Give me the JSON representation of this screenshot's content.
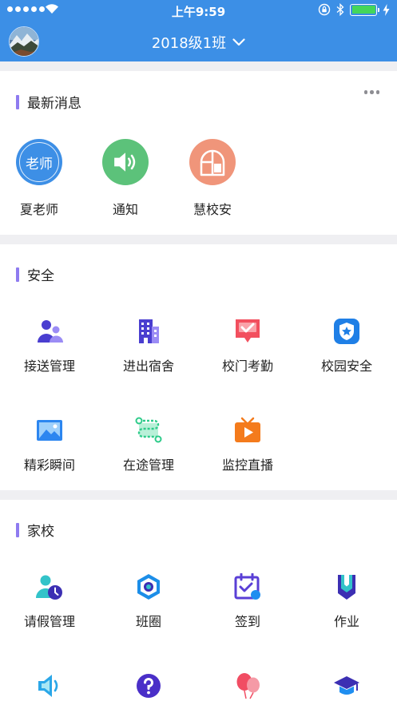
{
  "status_bar": {
    "time": "上午9:59"
  },
  "header": {
    "class_name": "2018级1班"
  },
  "news": {
    "title": "最新消息",
    "items": [
      {
        "label": "夏老师",
        "badge_text": "老师",
        "color": "#3d8fe6",
        "icon": "teacher-avatar-icon"
      },
      {
        "label": "通知",
        "color": "#5cc27a",
        "icon": "speaker-icon"
      },
      {
        "label": "慧校安",
        "color": "#f0957a",
        "icon": "school-safety-icon"
      }
    ]
  },
  "safety": {
    "title": "安全",
    "items": [
      {
        "label": "接送管理",
        "icon": "pickup-people-icon"
      },
      {
        "label": "进出宿舍",
        "icon": "dormitory-building-icon"
      },
      {
        "label": "校门考勤",
        "icon": "gate-attendance-icon"
      },
      {
        "label": "校园安全",
        "icon": "campus-shield-icon"
      },
      {
        "label": "精彩瞬间",
        "icon": "picture-icon"
      },
      {
        "label": "在途管理",
        "icon": "route-icon"
      },
      {
        "label": "监控直播",
        "icon": "tv-live-icon"
      }
    ]
  },
  "home_school": {
    "title": "家校",
    "items": [
      {
        "label": "请假管理",
        "icon": "leave-clock-icon"
      },
      {
        "label": "班圈",
        "icon": "class-circle-icon"
      },
      {
        "label": "签到",
        "icon": "check-in-calendar-icon"
      },
      {
        "label": "作业",
        "icon": "homework-bookmark-icon"
      },
      {
        "label": "",
        "icon": "announcement-speaker-icon"
      },
      {
        "label": "",
        "icon": "question-icon"
      },
      {
        "label": "",
        "icon": "balloon-icon"
      },
      {
        "label": "",
        "icon": "graduation-cap-icon"
      }
    ]
  },
  "colors": {
    "header_bg": "#3c8fe6",
    "section_accent": "#8e7bf0",
    "page_bg": "#efeff2"
  }
}
